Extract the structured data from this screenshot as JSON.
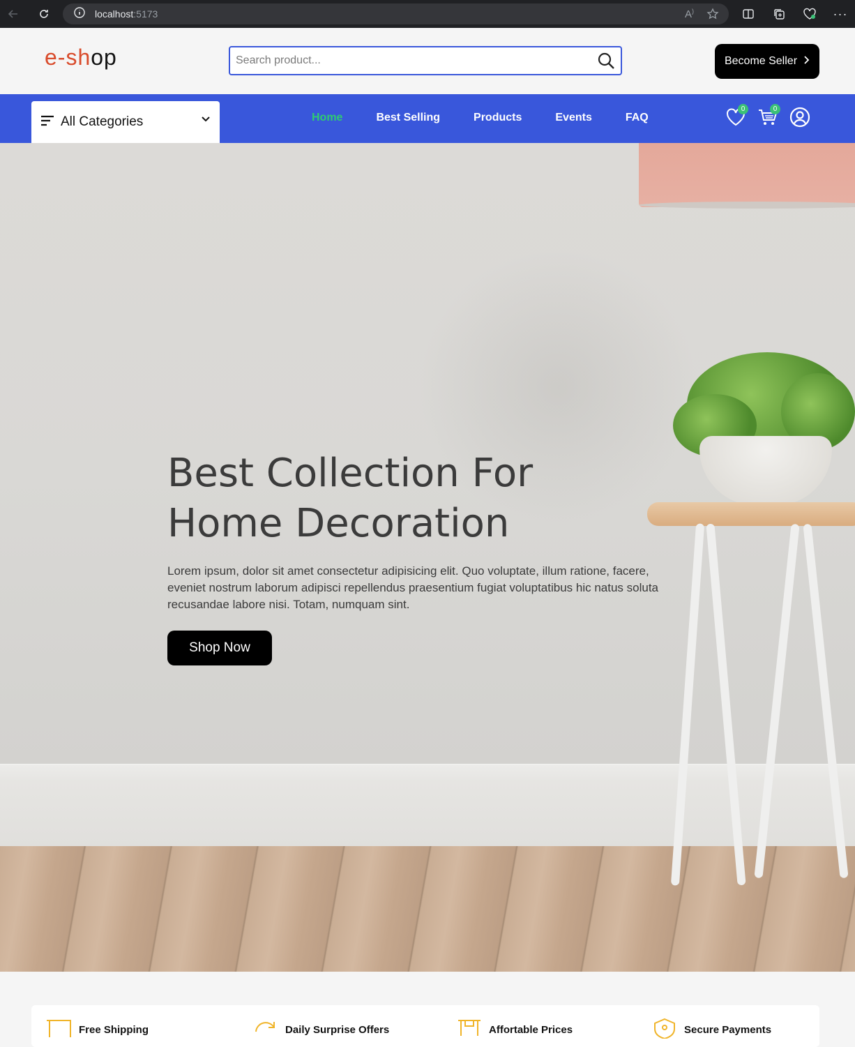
{
  "browser": {
    "url_host": "localhost",
    "url_port": ":5173"
  },
  "header": {
    "logo_e": "e-sh",
    "logo_rest": "op",
    "search_placeholder": "Search product...",
    "seller_label": "Become Seller"
  },
  "nav": {
    "categories_label": "All Categories",
    "links": [
      "Home",
      "Best Selling",
      "Products",
      "Events",
      "FAQ"
    ],
    "active_link": "Home",
    "wishlist_count": "0",
    "cart_count": "0"
  },
  "hero": {
    "title_line1": "Best Collection For",
    "title_line2": "Home Decoration",
    "description": "Lorem ipsum, dolor sit amet consectetur adipisicing elit. Quo voluptate, illum ratione, facere, eveniet nostrum laborum adipisci repellendus praesentium fugiat voluptatibus hic natus soluta recusandae labore nisi. Totam, numquam sint.",
    "cta_label": "Shop Now"
  },
  "features": [
    {
      "title": "Free Shipping",
      "icon": "shipping-icon"
    },
    {
      "title": "Daily Surprise Offers",
      "icon": "refresh-icon"
    },
    {
      "title": "Affortable Prices",
      "icon": "price-icon"
    },
    {
      "title": "Secure Payments",
      "icon": "shield-icon"
    }
  ],
  "colors": {
    "nav_bg": "#3957db",
    "active_link": "#2ecc71",
    "badge": "#3bc177",
    "feature_icon": "#f0b429"
  }
}
